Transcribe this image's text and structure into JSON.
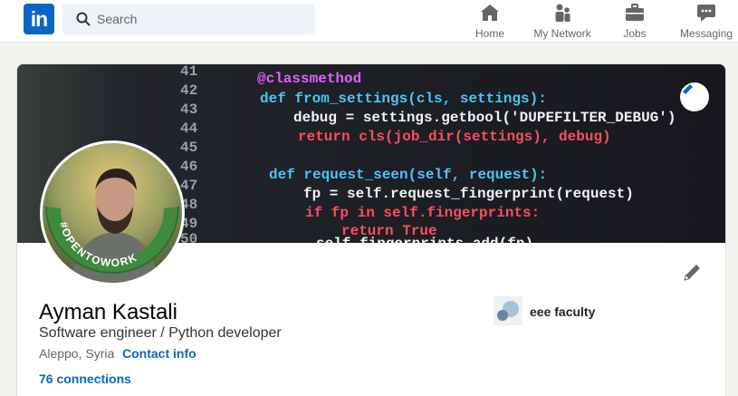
{
  "brand": {
    "logo_text": "in",
    "accent": "#0a66c2"
  },
  "search": {
    "placeholder": "Search",
    "icon": "search-icon"
  },
  "nav": {
    "items": [
      {
        "label": "Home",
        "icon": "home-icon"
      },
      {
        "label": "My Network",
        "icon": "network-icon"
      },
      {
        "label": "Jobs",
        "icon": "briefcase-icon"
      },
      {
        "label": "Messaging",
        "icon": "chat-icon"
      }
    ]
  },
  "banner": {
    "code_lines": [
      {
        "num": "41",
        "code": ""
      },
      {
        "num": "42",
        "code": "@classmethod"
      },
      {
        "num": "43",
        "code": "def from_settings(cls, settings):"
      },
      {
        "num": "44",
        "code": "debug = settings.getbool('DUPEFILTER_DEBUG')"
      },
      {
        "num": "45",
        "code": "return cls(job_dir(settings), debug)"
      },
      {
        "num": "46",
        "code": ""
      },
      {
        "num": "47",
        "code": "def request_seen(self, request):"
      },
      {
        "num": "48",
        "code": "fp = self.request_fingerprint(request)"
      },
      {
        "num": "49",
        "code": "if fp in self.fingerprints:"
      },
      {
        "num": "50",
        "code": "return True"
      },
      {
        "num": "",
        "code": "self.fingerprints.add(fp)"
      }
    ]
  },
  "avatar": {
    "badge_text": "#OPENTOWORK"
  },
  "profile": {
    "name": "Ayman Kastali",
    "headline": "Software engineer / Python developer",
    "location": "Aleppo, Syria",
    "contact_label": "Contact info",
    "connections": "76 connections",
    "education": "eee faculty"
  }
}
